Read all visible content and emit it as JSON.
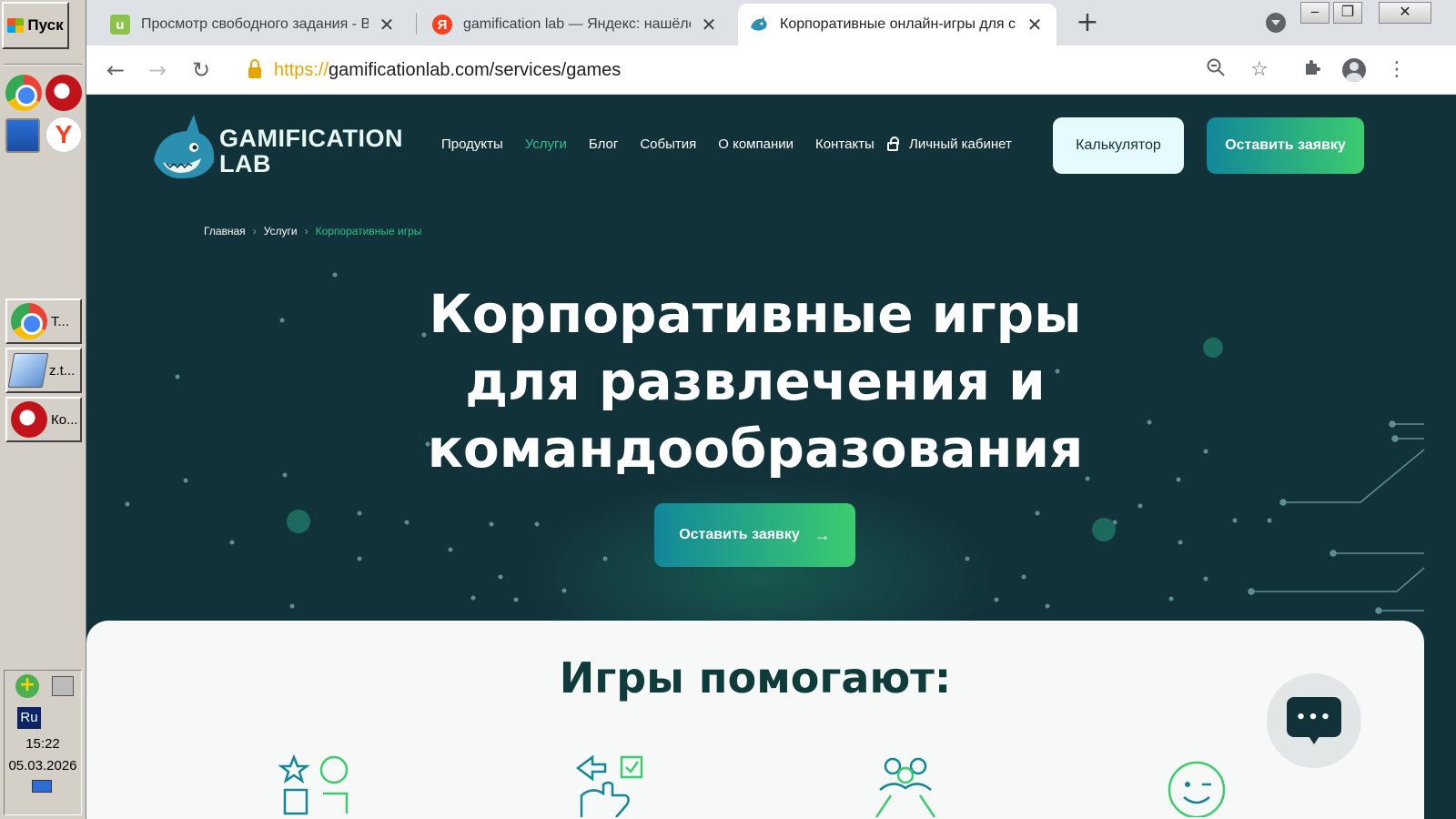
{
  "taskbar": {
    "start_label": "Пуск",
    "tasks": [
      {
        "label": "Т...",
        "icon": "chrome-icon"
      },
      {
        "label": "z.t...",
        "icon": "notepad-icon"
      },
      {
        "label": "Ко...",
        "icon": "opera-icon"
      }
    ],
    "tray": {
      "lang": "Ru",
      "time": "15:22",
      "date": "05.03.2026"
    }
  },
  "browser": {
    "tabs": [
      {
        "title": "Просмотр свободного задания - В",
        "favicon": "u-icon",
        "active": false
      },
      {
        "title": "gamification lab — Яндекс: нашёлс",
        "favicon": "yandex-icon",
        "active": false
      },
      {
        "title": "Корпоративные онлайн-игры для с",
        "favicon": "shark-icon",
        "active": true
      }
    ],
    "url_scheme": "https://",
    "url_rest": "gamificationlab.com/services/games"
  },
  "site": {
    "logo_line1": "GAMIFICATION",
    "logo_line2": "LAB",
    "menu": [
      "Продукты",
      "Услуги",
      "Блог",
      "События",
      "О компании",
      "Контакты"
    ],
    "cabinet": "Личный кабинет",
    "calc_button": "Калькулятор",
    "lead_button": "Оставить заявку",
    "breadcrumbs": [
      "Главная",
      "Услуги",
      "Корпоративные игры"
    ],
    "hero_lines": [
      "Корпоративные игры",
      "для развлечения и",
      "командообразования"
    ],
    "hero_button": "Оставить заявку",
    "section_title": "Игры помогают:",
    "chat_dots": "•••"
  },
  "colors": {
    "bg_dark": "#12323a",
    "accent_green": "#2fbf8f",
    "gradient_start": "#12879a",
    "gradient_end": "#3ccc6f"
  }
}
